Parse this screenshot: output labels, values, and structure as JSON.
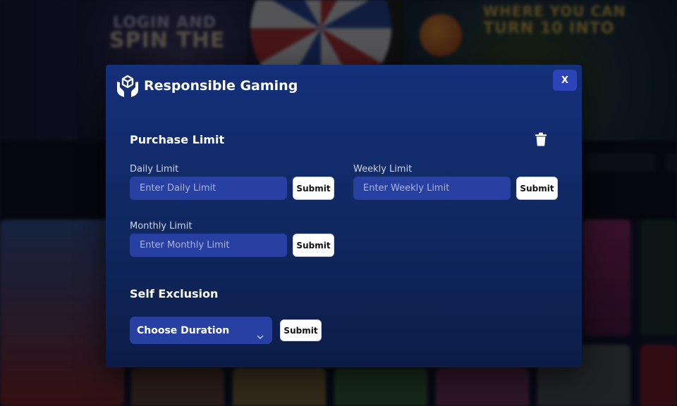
{
  "background": {
    "banner_left_line1": "LOGIN AND",
    "banner_left_line2": "SPIN THE",
    "banner_right_line1": "WHERE YOU CAN",
    "banner_right_line2": "TURN 10 INTO"
  },
  "modal": {
    "title": "Responsible Gaming",
    "close_label": "X",
    "icon": "hands-cube-icon"
  },
  "purchase_limit": {
    "title": "Purchase Limit",
    "delete_icon": "trash-icon",
    "daily": {
      "label": "Daily Limit",
      "placeholder": "Enter Daily Limit",
      "value": "",
      "submit_label": "Submit"
    },
    "weekly": {
      "label": "Weekly Limit",
      "placeholder": "Enter Weekly Limit",
      "value": "",
      "submit_label": "Submit"
    },
    "monthly": {
      "label": "Monthly Limit",
      "placeholder": "Enter Monthly Limit",
      "value": "",
      "submit_label": "Submit"
    }
  },
  "self_exclusion": {
    "title": "Self Exclusion",
    "duration_selected": "Choose Duration",
    "submit_label": "Submit"
  },
  "colors": {
    "modal_bg_top": "#14307a",
    "modal_bg_bottom": "#0c1c47",
    "input_bg": "#2840a1",
    "close_btn": "#2b45b8"
  }
}
